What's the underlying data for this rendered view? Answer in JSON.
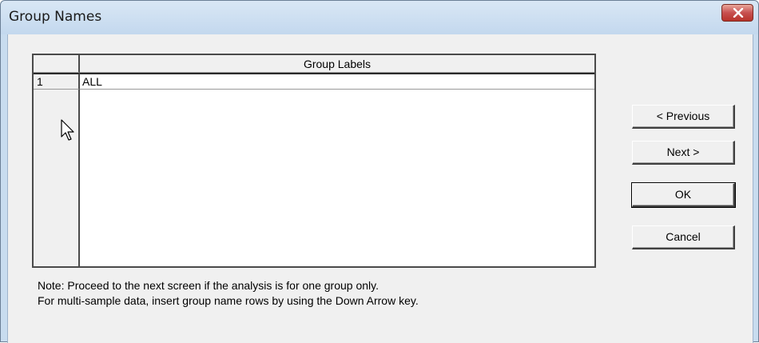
{
  "window": {
    "title": "Group Names",
    "close_icon": "close-icon"
  },
  "grid": {
    "column_header": "Group Labels",
    "rows": [
      {
        "number": "1",
        "label": "ALL"
      }
    ]
  },
  "buttons": {
    "previous": "< Previous",
    "next": "Next >",
    "ok": "OK",
    "cancel": "Cancel"
  },
  "note": {
    "line1": "Note: Proceed to the next screen if the analysis is for one group only.",
    "line2": "For multi-sample data, insert group name rows by using the Down Arrow key."
  },
  "colors": {
    "title_bar": "#c8dcef",
    "close_button": "#c75050",
    "dialog_face": "#f0f0f0"
  }
}
